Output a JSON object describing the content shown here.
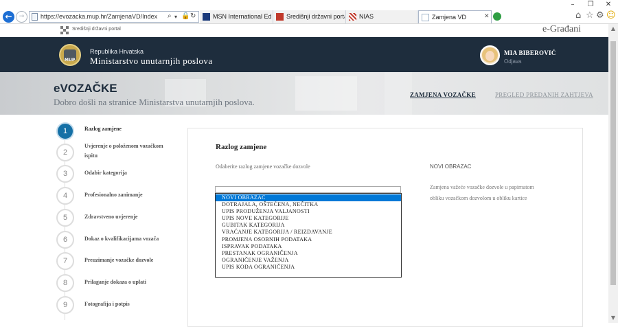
{
  "browser": {
    "url": "https://evozacka.mup.hr/ZamjenaVD/Index",
    "window_controls": {
      "minimize": "–",
      "restore": "❐",
      "close": "✕"
    },
    "back": "←",
    "forward": "→",
    "tabs": [
      {
        "title": "MSN International Edition -...",
        "color": "#1b3a7a"
      },
      {
        "title": "Središnji državni portal - V...",
        "color": "#c0392b"
      },
      {
        "title": "NIAS",
        "color": "#c0392b"
      },
      {
        "title": "Zamjena VD",
        "color": "#9fb3c8",
        "close": "✕"
      }
    ],
    "icons": [
      "search-icon",
      "lock-icon",
      "refresh-icon",
      "home-icon",
      "favorites-star-icon",
      "settings-gear-icon",
      "smiley-icon"
    ]
  },
  "site_bar": {
    "gov_label": "Središnji državni portal",
    "brand": "e-Građani"
  },
  "header": {
    "country": "Republika Hrvatska",
    "ministry": "Ministarstvo unutarnjih poslova",
    "logo_text": "MUP",
    "user": "MIA BIBEROVIĆ",
    "logout": "Odjava"
  },
  "hero": {
    "title": "eVOZAČKE",
    "subtitle": "Dobro došli na stranice Ministarstva unutarnjih poslova.",
    "nav": [
      "ZAMJENA VOZAČKE",
      "PREGLED PREDANIH ZAHTJEVA"
    ]
  },
  "steps": [
    {
      "number": "1",
      "label": "Razlog zamjene",
      "active": true
    },
    {
      "number": "2",
      "label": "Uvjerenje o položenom vozačkom ispitu",
      "active": false
    },
    {
      "number": "3",
      "label": "Odabir kategorija",
      "active": false
    },
    {
      "number": "4",
      "label": "Profesionalno zanimanje",
      "active": false
    },
    {
      "number": "5",
      "label": "Zdravstveno uvjerenje",
      "active": false
    },
    {
      "number": "6",
      "label": "Dokaz o kvalifikacijama vozača",
      "active": false
    },
    {
      "number": "7",
      "label": "Preuzimanje vozačke dozvole",
      "active": false
    },
    {
      "number": "8",
      "label": "Prilaganje dokaza o uplati",
      "active": false
    },
    {
      "number": "9",
      "label": "Fotografija i potpis",
      "active": false
    }
  ],
  "form": {
    "title": "Razlog zamjene",
    "field_label": "Odaberite razlog zamjene vozačke dozvole",
    "selected_value": "NOVI OBRAZAC",
    "description_lines": [
      "Zamjena važeće vozačke dozvole u papirnatom",
      "obliku vozačkom dozvolom u obliku kartice"
    ],
    "options": [
      "NOVI OBRAZAC",
      "DOTRAJALA, OŠTEĆENA, NEČITKA",
      "UPIS PRODUŽENJA VALJANOSTI",
      "UPIS NOVE KATEGORIJE",
      "GUBITAK KATEGORIJA",
      "VRAĆANJE KATEGORIJA / REIZDAVANJE",
      "PROMJENA OSOBNIH PODATAKA",
      "ISPRAVAK PODATAKA",
      "PRESTANAK OGRANIČENJA",
      "OGRANIČENJE VAŽENJA",
      "UPIS KODA OGRANIČENJA"
    ],
    "selected_index": 0
  },
  "scrollbar": {
    "up": "▲",
    "down": "▼"
  }
}
